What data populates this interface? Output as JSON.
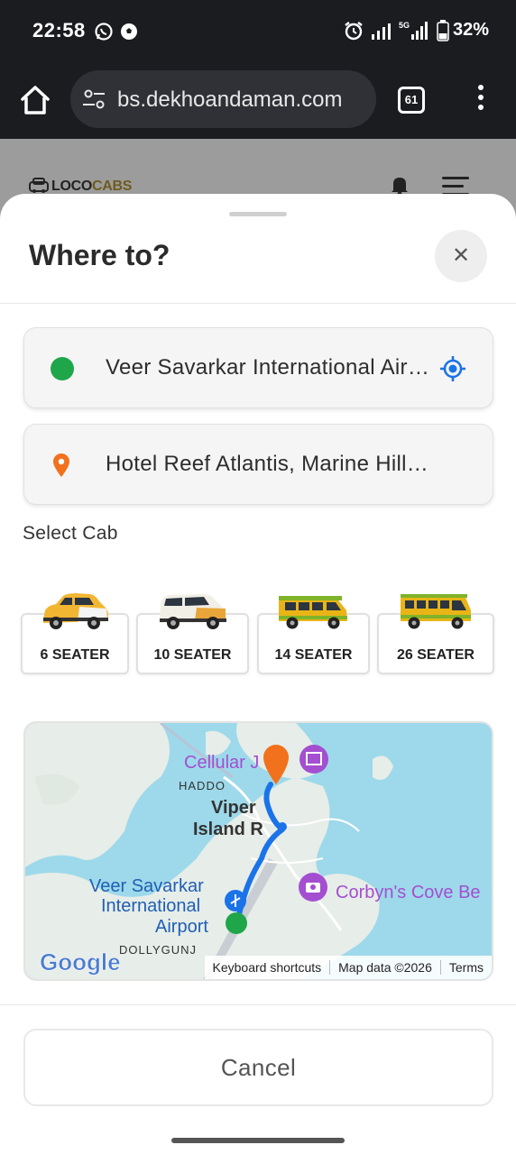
{
  "status_bar": {
    "time": "22:58",
    "battery": "32%",
    "network": "5G"
  },
  "browser": {
    "url": "bs.dekhoandaman.com",
    "tab_count": "61"
  },
  "site": {
    "logo_loco": "LOCO",
    "logo_cabs": "CABS"
  },
  "sheet": {
    "title": "Where to?",
    "close_symbol": "✕",
    "pickup": "Veer Savarkar International Airport",
    "dropoff": "Hotel Reef Atlantis, Marine Hill, South Andaman",
    "select_cab_label": "Select Cab",
    "cabs": [
      {
        "label": "6 SEATER"
      },
      {
        "label": "10 SEATER"
      },
      {
        "label": "14 SEATER"
      },
      {
        "label": "26 SEATER"
      }
    ],
    "cancel_label": "Cancel"
  },
  "map": {
    "labels": {
      "cellular": "Cellular J",
      "haddo": "HADDO",
      "viper_1": "Viper",
      "viper_2": "Island R",
      "airport_1": "Veer Savarkar",
      "airport_2": "International",
      "airport_3": "Airport",
      "corbyn": "Corbyn's Cove Be",
      "dollygunj": "DOLLYGUNJ",
      "google": "Google"
    },
    "attribution": {
      "shortcuts": "Keyboard shortcuts",
      "map_data": "Map data ©2026",
      "terms": "Terms"
    },
    "colors": {
      "water": "#9dd9ea",
      "land": "#e7ede8",
      "route": "#1a73e8",
      "destination": "#f2711c",
      "poi": "#a34fd0"
    }
  },
  "colors": {
    "pickup": "#1fa64a",
    "dropoff": "#f2711c",
    "gps": "#1a73e8"
  }
}
